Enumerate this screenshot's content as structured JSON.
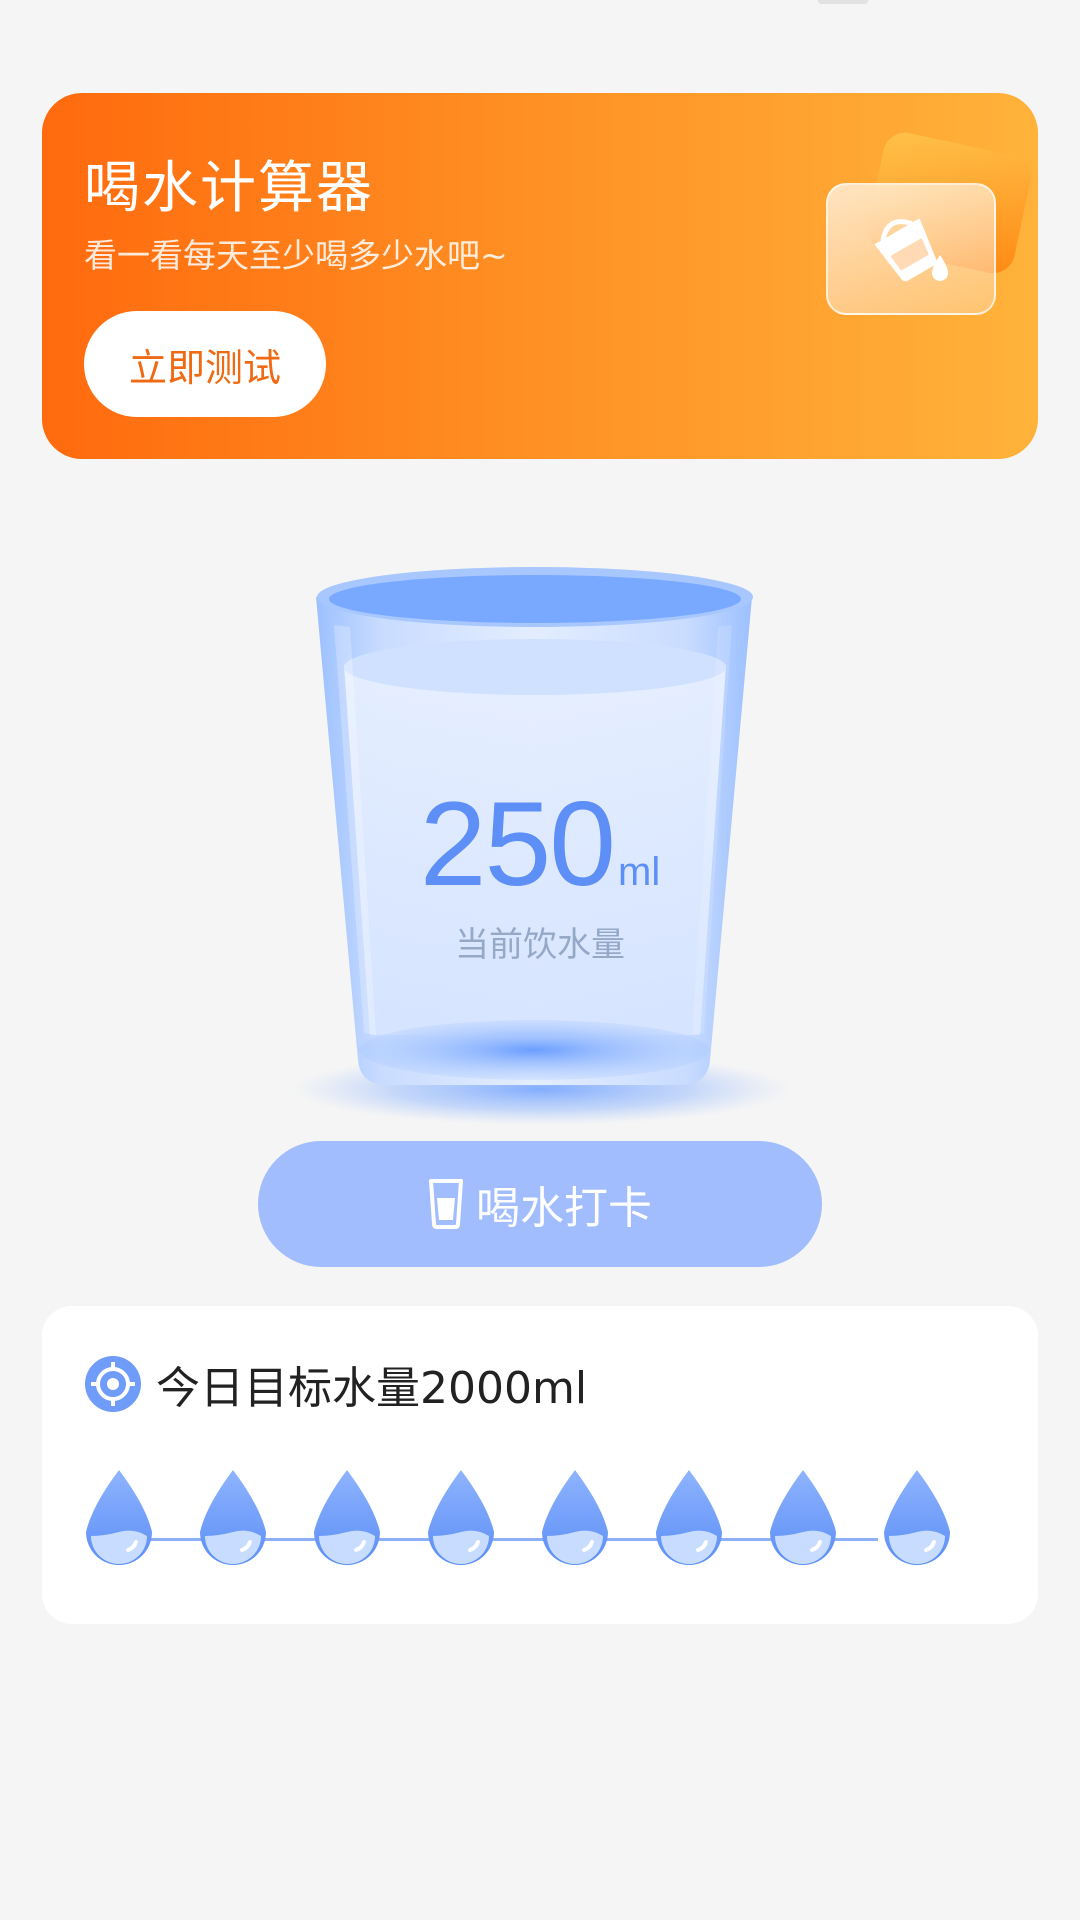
{
  "banner": {
    "title": "喝水计算器",
    "subtitle": "看一看每天至少喝多少水吧~",
    "button_label": "立即测试",
    "icon": "water-pour-icon"
  },
  "cup": {
    "amount": "250",
    "unit": "ml",
    "caption": "当前饮水量"
  },
  "checkin": {
    "label": "喝水打卡",
    "icon": "cup-icon"
  },
  "goal": {
    "icon": "target-icon",
    "text": "今日目标水量2000ml",
    "drops": [
      {
        "name": "drop-1"
      },
      {
        "name": "drop-2"
      },
      {
        "name": "drop-3"
      },
      {
        "name": "drop-4"
      },
      {
        "name": "drop-5"
      },
      {
        "name": "drop-6"
      },
      {
        "name": "drop-7"
      },
      {
        "name": "drop-8"
      }
    ]
  },
  "colors": {
    "primary_blue": "#5e8ff7",
    "button_blue": "#a1bdfd",
    "banner_orange_start": "#ff6a0e",
    "banner_orange_end": "#ffb33a",
    "button_text_orange": "#ef6a12"
  }
}
